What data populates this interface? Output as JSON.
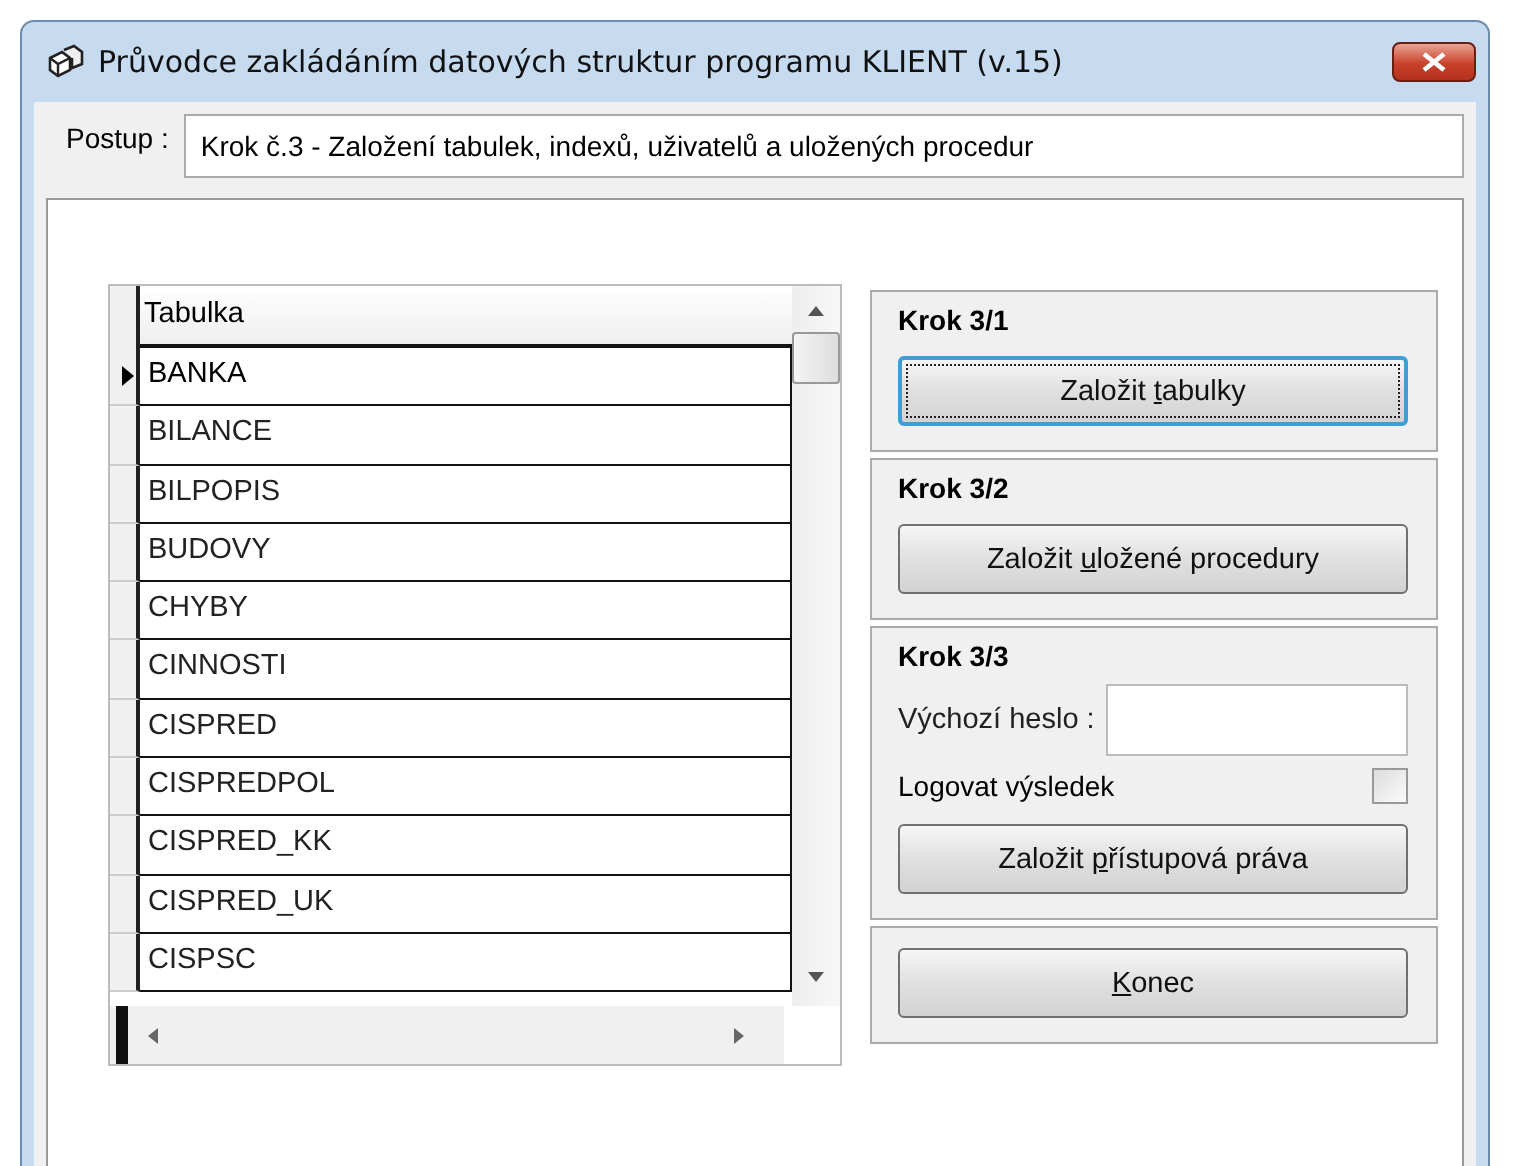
{
  "window": {
    "title": "Průvodce zakládáním datových struktur programu KLIENT (v.15)"
  },
  "step": {
    "label": "Postup :",
    "value": "Krok č.3 - Založení tabulek, indexů, uživatelů a uložených procedur"
  },
  "table": {
    "columns": [
      "Tabulka"
    ],
    "rows": [
      {
        "name": "BANKA",
        "selected": true
      },
      {
        "name": "BILANCE",
        "selected": false
      },
      {
        "name": "BILPOPIS",
        "selected": false
      },
      {
        "name": "BUDOVY",
        "selected": false
      },
      {
        "name": "CHYBY",
        "selected": false
      },
      {
        "name": "CINNOSTI",
        "selected": false
      },
      {
        "name": "CISPRED",
        "selected": false
      },
      {
        "name": "CISPREDPOL",
        "selected": false
      },
      {
        "name": "CISPRED_KK",
        "selected": false
      },
      {
        "name": "CISPRED_UK",
        "selected": false
      },
      {
        "name": "CISPSC",
        "selected": false
      }
    ]
  },
  "groups": [
    {
      "title": "Krok 3/1",
      "items": [
        {
          "kind": "button",
          "before": "Založit ",
          "access_key": "t",
          "after": "abulky",
          "focused": true
        }
      ]
    },
    {
      "title": "Krok 3/2",
      "items": [
        {
          "kind": "button",
          "before": "Založit ",
          "access_key": "u",
          "after": "ložené procedury",
          "focused": false
        }
      ]
    },
    {
      "title": "Krok 3/3",
      "items": [
        {
          "kind": "field",
          "label": "Výchozí heslo :"
        },
        {
          "kind": "checkbox",
          "label": "Logovat výsledek",
          "checked": false
        },
        {
          "kind": "button",
          "before": "Založit ",
          "access_key": "p",
          "after": "řístupová práva",
          "focused": false
        }
      ]
    },
    {
      "items": [
        {
          "kind": "button",
          "access_key": "K",
          "after": "onec",
          "focused": false
        }
      ]
    }
  ]
}
